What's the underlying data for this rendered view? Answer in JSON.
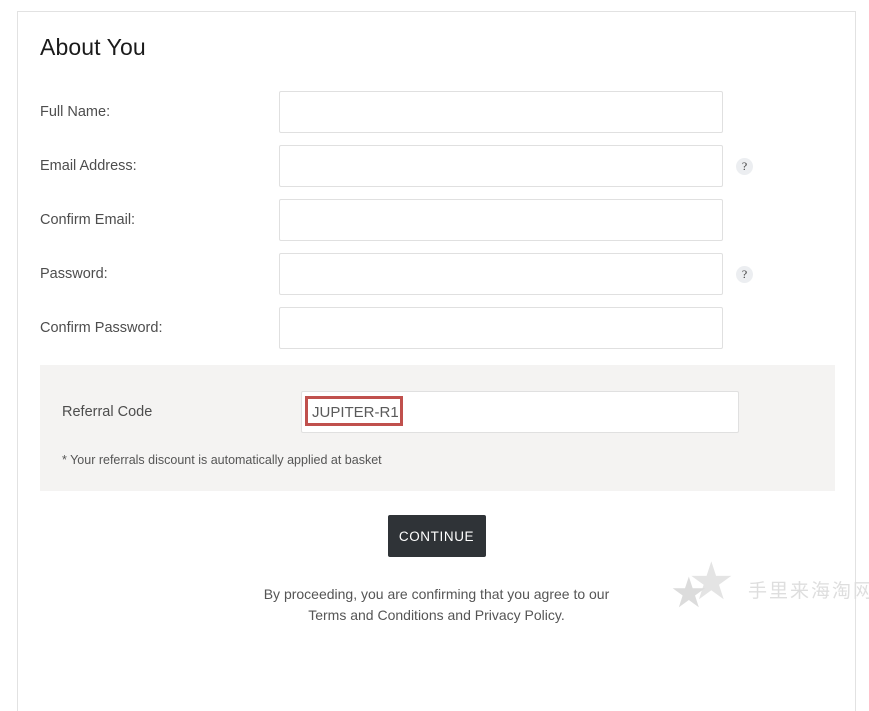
{
  "page": {
    "title": "About You"
  },
  "form": {
    "fields": [
      {
        "label": "Full Name:",
        "value": "",
        "placeholder": "",
        "type": "text",
        "help": false
      },
      {
        "label": "Email Address:",
        "value": "",
        "placeholder": "",
        "type": "text",
        "help": true
      },
      {
        "label": "Confirm Email:",
        "value": "",
        "placeholder": "",
        "type": "text",
        "help": false
      },
      {
        "label": "Password:",
        "value": "",
        "placeholder": "",
        "type": "password",
        "help": true
      },
      {
        "label": "Confirm Password:",
        "value": "",
        "placeholder": "",
        "type": "password",
        "help": false
      }
    ],
    "help_icon": "?"
  },
  "referral": {
    "label": "Referral Code",
    "value": "JUPITER-R1",
    "placeholder": "",
    "note": "* Your referrals discount is automatically applied at basket",
    "highlight_color": "#c0504d",
    "panel_color": "#f4f3f2"
  },
  "actions": {
    "continue_label": "CONTINUE",
    "continue_color": "#2f3337"
  },
  "legal": {
    "line1": "By proceeding, you are confirming that you agree to our",
    "line2": "Terms and Conditions and Privacy Policy."
  },
  "watermark": {
    "text": "手里来海淘网",
    "star_glyph": "★",
    "color": "#dedede"
  }
}
